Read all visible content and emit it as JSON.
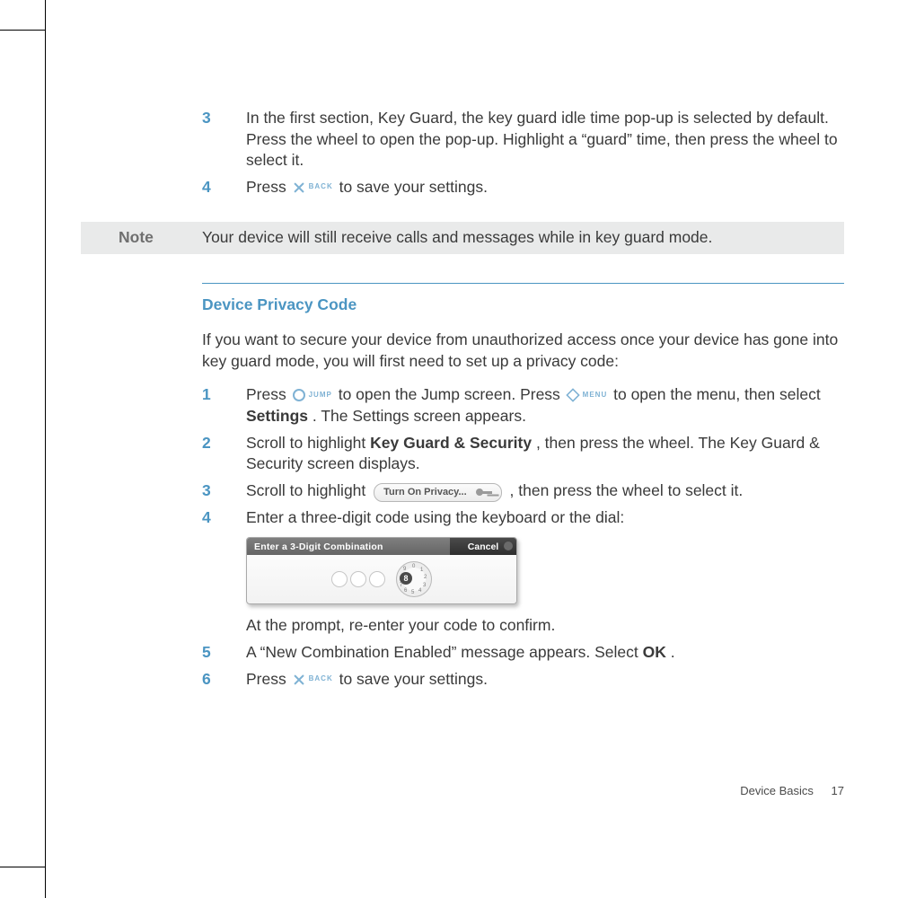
{
  "buttons": {
    "back": "BACK",
    "jump": "JUMP",
    "menu": "MENU"
  },
  "steps_top": [
    {
      "n": "3",
      "text_a": "In the first section, Key Guard, the key guard idle time pop-up is selected by default. Press the wheel to open the pop-up. Highlight a “guard” time, then press the wheel to select it."
    },
    {
      "n": "4",
      "text_a": "Press ",
      "text_b": " to save your settings."
    }
  ],
  "note": {
    "label": "Note",
    "text": "Your device will still receive calls and messages while in key guard mode."
  },
  "section_title": "Device Privacy Code",
  "intro": "If you want to secure your device from unauthorized access once your device has gone into key guard mode, you will first need to set up a privacy code:",
  "steps": {
    "s1": {
      "n": "1",
      "a": "Press ",
      "b": " to open the Jump screen. Press ",
      "c": " to open the menu, then select ",
      "settings": "Settings",
      "d": ". The Settings screen appears."
    },
    "s2": {
      "n": "2",
      "a": "Scroll to highlight ",
      "kg": "Key Guard & Security",
      "b": ", then press the wheel. The Key Guard & Security screen displays."
    },
    "s3": {
      "n": "3",
      "a": "Scroll to highlight ",
      "chip": "Turn On Privacy...",
      "b": " , then press the wheel to select it."
    },
    "s4": {
      "n": "4",
      "a": "Enter a three-digit code using the keyboard or the dial:",
      "after": "At the prompt, re-enter your code to confirm."
    },
    "s5": {
      "n": "5",
      "a": "A “New Combination Enabled” message appears. Select ",
      "ok": "OK",
      "b": "."
    },
    "s6": {
      "n": "6",
      "a": "Press ",
      "b": " to save your settings."
    }
  },
  "dialog": {
    "title": "Enter a 3-Digit Combination",
    "cancel": "Cancel",
    "dial_current": "8"
  },
  "footer": {
    "section": "Device Basics",
    "page": "17"
  }
}
